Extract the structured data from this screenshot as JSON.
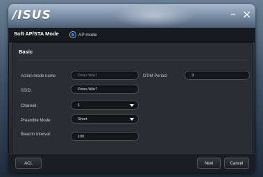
{
  "window": {
    "logo_text": "/ISUS",
    "minimize_glyph": "–",
    "close_glyph": "×"
  },
  "mode": {
    "title": "Soft AP/STA Mode",
    "radio_label": "AP mode",
    "radio_selected": true
  },
  "basic": {
    "section_title": "Basic",
    "action_mode_name_label": "Action mode name",
    "action_mode_name_value": "Peter-Win7",
    "dtim_label": "DTIM Period:",
    "dtim_value": "3",
    "ssid_label": "SSID:",
    "ssid_value": "Peter-Win7",
    "channel_label": "Channel:",
    "channel_value": "1",
    "preamble_label": "Preamble Mode:",
    "preamble_value": "Short",
    "beacon_label": "Beacon Interval:",
    "beacon_value": "100"
  },
  "buttons": {
    "acl": "ACL",
    "next": "Next",
    "cancel": "Cancel"
  },
  "icons": {
    "logo": "asus-logo-icon",
    "minimize": "minimize-icon",
    "close": "close-icon",
    "dropdown": "chevron-down-icon"
  }
}
